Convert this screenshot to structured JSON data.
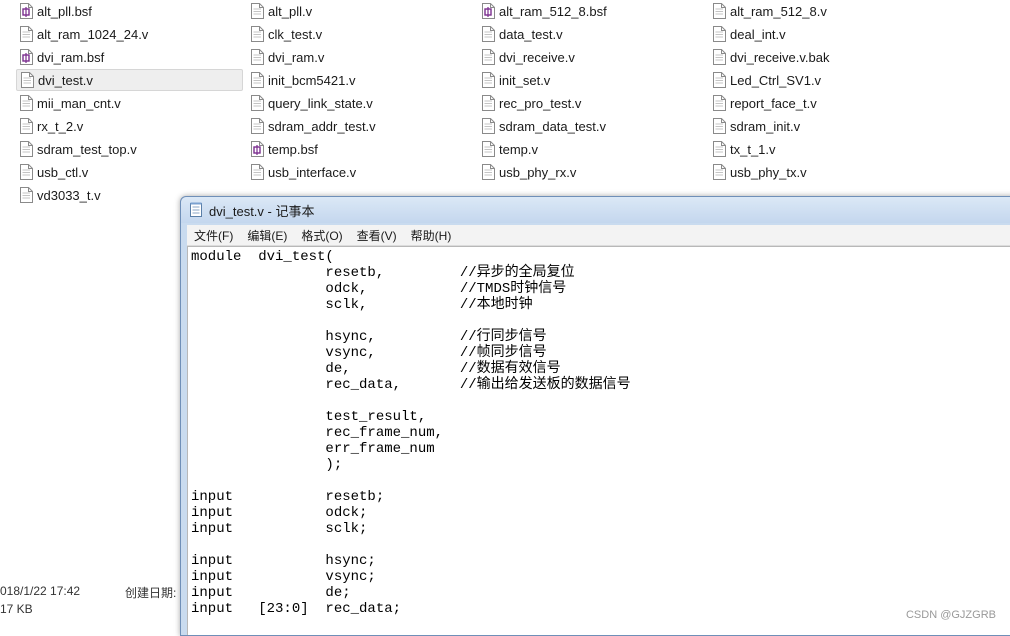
{
  "files": [
    {
      "name": "alt_pll.bsf",
      "icon": "bsf-file-icon",
      "col": 0,
      "row": 0
    },
    {
      "name": "alt_pll.v",
      "icon": "text-file-icon",
      "col": 1,
      "row": 0
    },
    {
      "name": "alt_ram_512_8.bsf",
      "icon": "bsf-file-icon",
      "col": 2,
      "row": 0
    },
    {
      "name": "alt_ram_512_8.v",
      "icon": "text-file-icon",
      "col": 3,
      "row": 0
    },
    {
      "name": "alt_ram_1024_24.v",
      "icon": "text-file-icon",
      "col": 0,
      "row": 1
    },
    {
      "name": "clk_test.v",
      "icon": "text-file-icon",
      "col": 1,
      "row": 1
    },
    {
      "name": "data_test.v",
      "icon": "text-file-icon",
      "col": 2,
      "row": 1
    },
    {
      "name": "deal_int.v",
      "icon": "text-file-icon",
      "col": 3,
      "row": 1
    },
    {
      "name": "dvi_ram.bsf",
      "icon": "bsf-file-icon",
      "col": 0,
      "row": 2
    },
    {
      "name": "dvi_ram.v",
      "icon": "text-file-icon",
      "col": 1,
      "row": 2
    },
    {
      "name": "dvi_receive.v",
      "icon": "text-file-icon",
      "col": 2,
      "row": 2
    },
    {
      "name": "dvi_receive.v.bak",
      "icon": "text-file-icon",
      "col": 3,
      "row": 2
    },
    {
      "name": "dvi_test.v",
      "icon": "text-file-icon",
      "col": 0,
      "row": 3,
      "selected": true
    },
    {
      "name": "init_bcm5421.v",
      "icon": "text-file-icon",
      "col": 1,
      "row": 3
    },
    {
      "name": "init_set.v",
      "icon": "text-file-icon",
      "col": 2,
      "row": 3
    },
    {
      "name": "Led_Ctrl_SV1.v",
      "icon": "text-file-icon",
      "col": 3,
      "row": 3
    },
    {
      "name": "mii_man_cnt.v",
      "icon": "text-file-icon",
      "col": 0,
      "row": 4
    },
    {
      "name": "query_link_state.v",
      "icon": "text-file-icon",
      "col": 1,
      "row": 4
    },
    {
      "name": "rec_pro_test.v",
      "icon": "text-file-icon",
      "col": 2,
      "row": 4
    },
    {
      "name": "report_face_t.v",
      "icon": "text-file-icon",
      "col": 3,
      "row": 4
    },
    {
      "name": "rx_t_2.v",
      "icon": "text-file-icon",
      "col": 0,
      "row": 5
    },
    {
      "name": "sdram_addr_test.v",
      "icon": "text-file-icon",
      "col": 1,
      "row": 5
    },
    {
      "name": "sdram_data_test.v",
      "icon": "text-file-icon",
      "col": 2,
      "row": 5
    },
    {
      "name": "sdram_init.v",
      "icon": "text-file-icon",
      "col": 3,
      "row": 5
    },
    {
      "name": "sdram_test_top.v",
      "icon": "text-file-icon",
      "col": 0,
      "row": 6
    },
    {
      "name": "temp.bsf",
      "icon": "bsf-file-icon",
      "col": 1,
      "row": 6
    },
    {
      "name": "temp.v",
      "icon": "text-file-icon",
      "col": 2,
      "row": 6
    },
    {
      "name": "tx_t_1.v",
      "icon": "text-file-icon",
      "col": 3,
      "row": 6
    },
    {
      "name": "usb_ctl.v",
      "icon": "text-file-icon",
      "col": 0,
      "row": 7
    },
    {
      "name": "usb_interface.v",
      "icon": "text-file-icon",
      "col": 1,
      "row": 7
    },
    {
      "name": "usb_phy_rx.v",
      "icon": "text-file-icon",
      "col": 2,
      "row": 7
    },
    {
      "name": "usb_phy_tx.v",
      "icon": "text-file-icon",
      "col": 3,
      "row": 7
    },
    {
      "name": "vd3033_t.v",
      "icon": "text-file-icon",
      "col": 0,
      "row": 8
    }
  ],
  "details": {
    "modified": "018/1/22 17:42",
    "size": "17 KB",
    "created_label": "创建日期:"
  },
  "notepad": {
    "title": "dvi_test.v - 记事本",
    "menu": [
      "文件(F)",
      "编辑(E)",
      "格式(O)",
      "查看(V)",
      "帮助(H)"
    ],
    "content": "module  dvi_test(\n                resetb,         //异步的全局复位\n                odck,           //TMDS时钟信号\n                sclk,           //本地时钟\n\n                hsync,          //行同步信号\n                vsync,          //帧同步信号\n                de,             //数据有效信号\n                rec_data,       //输出给发送板的数据信号\n\n                test_result,\n                rec_frame_num,\n                err_frame_num\n                );\n\ninput           resetb;\ninput           odck;\ninput           sclk;\n\ninput           hsync;\ninput           vsync;\ninput           de;\ninput   [23:0]  rec_data;"
  },
  "watermark": "CSDN @GJZGRB"
}
